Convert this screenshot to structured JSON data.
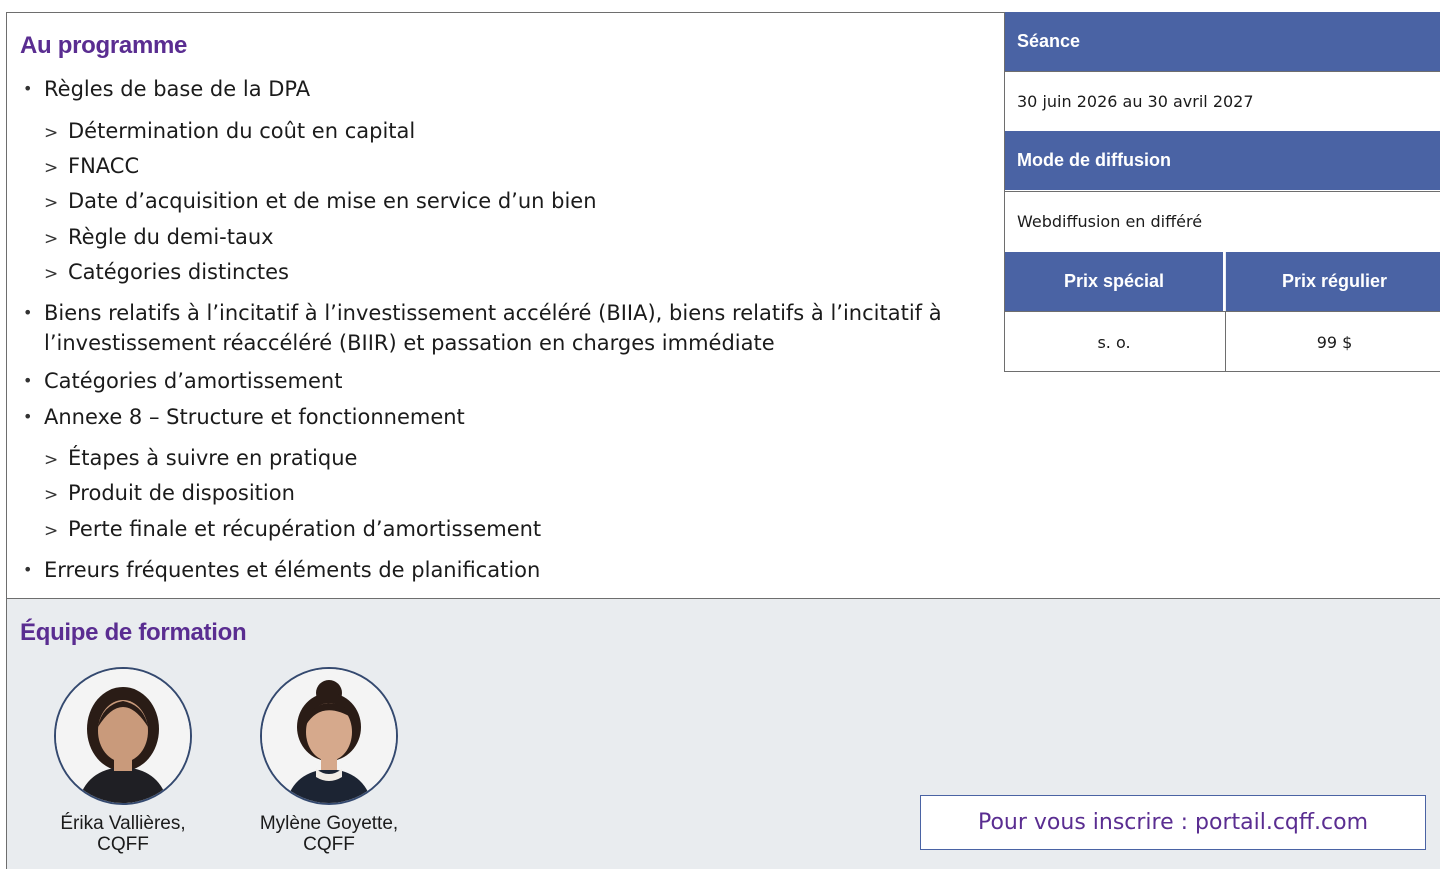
{
  "program": {
    "title": "Au programme",
    "items": [
      {
        "level": 1,
        "text": "Règles de base de la DPA"
      },
      {
        "level": 2,
        "text": "Détermination du coût en capital"
      },
      {
        "level": 2,
        "text": "FNACC"
      },
      {
        "level": 2,
        "text": "Date d’acquisition et de mise en service d’un bien"
      },
      {
        "level": 2,
        "text": "Règle du demi-taux"
      },
      {
        "level": 2,
        "text": "Catégories distinctes"
      },
      {
        "level": 1,
        "text": "Biens relatifs à l’incitatif à l’investissement accéléré (BIIA), biens relatifs à l’incitatif à l’investissement réaccéléré (BIIR) et passation en charges immédiate"
      },
      {
        "level": 1,
        "text": "Catégories d’amortissement"
      },
      {
        "level": 1,
        "text": "Annexe 8 – Structure et fonctionnement"
      },
      {
        "level": 2,
        "text": "Étapes à suivre en pratique"
      },
      {
        "level": 2,
        "text": "Produit de disposition"
      },
      {
        "level": 2,
        "text": "Perte finale et récupération d’amortissement"
      },
      {
        "level": 1,
        "text": "Erreurs fréquentes et éléments de planification"
      }
    ],
    "bullet_glyph": "•",
    "sub_glyph": ">"
  },
  "info": {
    "seance_label": "Séance",
    "seance_value": "30 juin 2026 au 30 avril 2027",
    "mode_label": "Mode de diffusion",
    "mode_value": "Webdiffusion en différé",
    "price_special_label": "Prix spécial",
    "price_regular_label": "Prix régulier",
    "price_special_value": "s. o.",
    "price_regular_value": "99 $"
  },
  "team": {
    "title": "Équipe de formation",
    "members": [
      {
        "name": "Érika Vallières,",
        "title": "CQFF"
      },
      {
        "name": "Mylène Goyette,",
        "title": "CQFF"
      }
    ]
  },
  "register": {
    "label": "Pour vous inscrire : portail.cqff.com"
  },
  "colors": {
    "accent_purple": "#5a2d91",
    "header_blue": "#4a63a4",
    "team_bg": "#e9ecef"
  }
}
